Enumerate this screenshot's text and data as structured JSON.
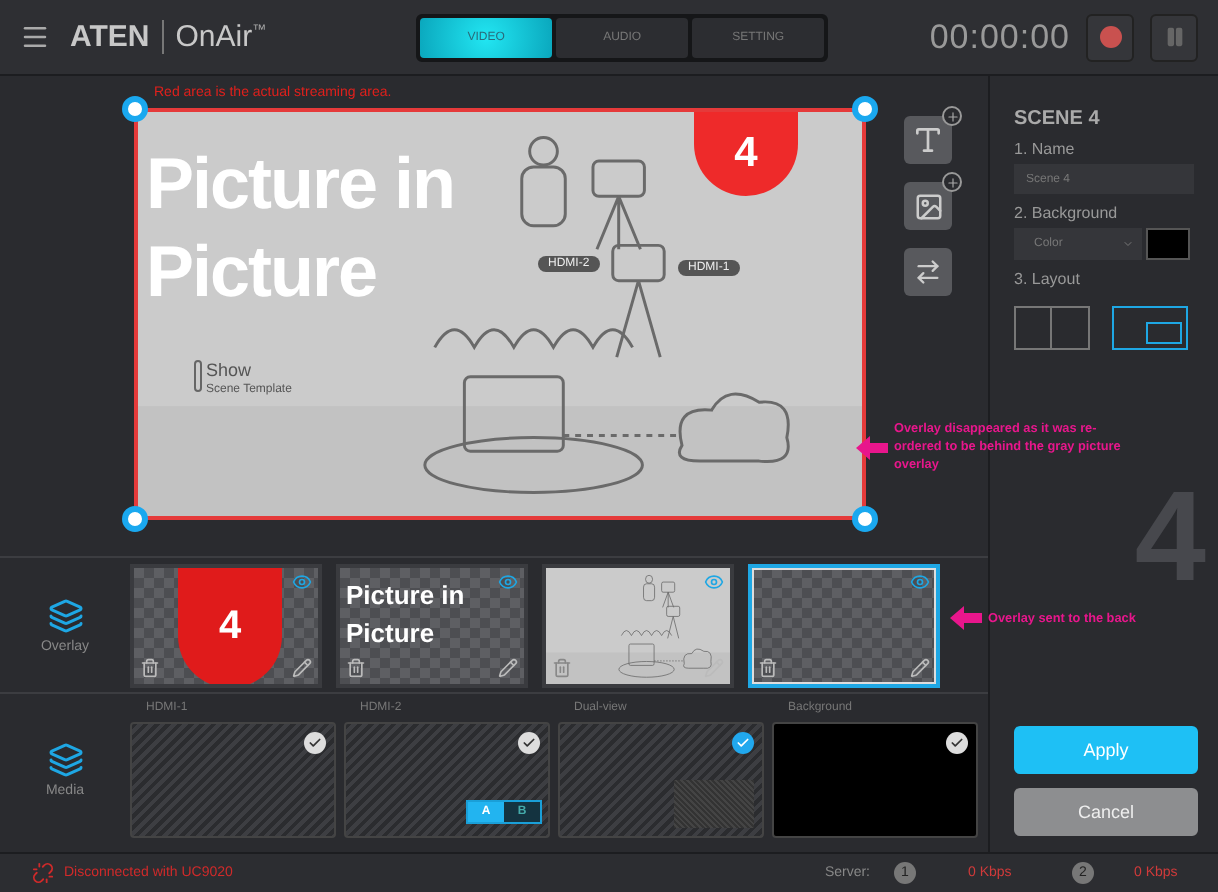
{
  "header": {
    "brand": "ATEN",
    "product": "OnAir",
    "trademark": "™",
    "timer": "00:00:00",
    "recording": false,
    "tabs": [
      {
        "label": "VIDEO",
        "selected": true
      },
      {
        "label": "AUDIO",
        "selected": false
      },
      {
        "label": "SETTING",
        "selected": false
      }
    ]
  },
  "canvas": {
    "note": "Red area is the actual streaming area.",
    "badge": "4",
    "title": "Picture in Picture",
    "cameras": [
      "HDMI-2",
      "HDMI-1"
    ],
    "template": {
      "title": "Show",
      "subtitle": "Scene Template"
    },
    "callout": "Overlay disappeared as it was re-ordered to be behind the gray picture overlay"
  },
  "overlay": {
    "label": "Overlay",
    "callout": "Overlay sent to the back",
    "items": [
      {
        "kind": "badge",
        "text": "4",
        "selected": false
      },
      {
        "kind": "text",
        "text": "Picture in Picture",
        "selected": false
      },
      {
        "kind": "picture",
        "selected": false
      },
      {
        "kind": "empty",
        "selected": true
      }
    ]
  },
  "media": {
    "label": "Media",
    "items": [
      {
        "label": "HDMI-1",
        "kind": "pattern",
        "selected": false
      },
      {
        "label": "HDMI-2",
        "kind": "pattern",
        "selected": false,
        "switch": [
          {
            "label": "A",
            "selected": true
          },
          {
            "label": "B",
            "selected": false
          }
        ]
      },
      {
        "label": "Dual-view",
        "kind": "dual",
        "selected": true
      },
      {
        "label": "Background",
        "kind": "black",
        "selected": false
      }
    ]
  },
  "scene": {
    "title": "SCENE 4",
    "name_label": "1. Name",
    "name_placeholder": "Scene 4",
    "background_label": "2. Background",
    "background_type": "Color",
    "layout_label": "3. Layout",
    "layouts": [
      {
        "kind": "split",
        "selected": false
      },
      {
        "kind": "pip",
        "selected": true
      }
    ],
    "watermark": "4",
    "apply": "Apply",
    "cancel": "Cancel"
  },
  "status": {
    "message": "Disconnected with UC9020",
    "server_label": "Server:",
    "servers": [
      {
        "index": "1",
        "rate": "0 Kbps"
      },
      {
        "index": "2",
        "rate": "0 Kbps"
      }
    ]
  }
}
